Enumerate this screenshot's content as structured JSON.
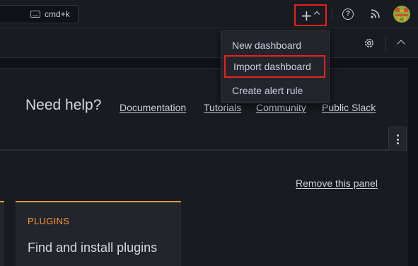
{
  "topbar": {
    "search_shortcut": "cmd+k"
  },
  "add_menu": {
    "items": [
      {
        "label": "New dashboard"
      },
      {
        "label": "Import dashboard"
      },
      {
        "label": "Create alert rule"
      }
    ]
  },
  "help": {
    "title": "Need help?",
    "links": [
      "Documentation",
      "Tutorials",
      "Community",
      "Public Slack"
    ]
  },
  "panel": {
    "remove_label": "Remove this panel",
    "card": {
      "label": "PLUGINS",
      "title": "Find and install plugins"
    }
  },
  "colors": {
    "accent_orange": "#ff9830",
    "highlight_red": "#e8221f",
    "background": "#111217",
    "surface": "#181b1f"
  }
}
